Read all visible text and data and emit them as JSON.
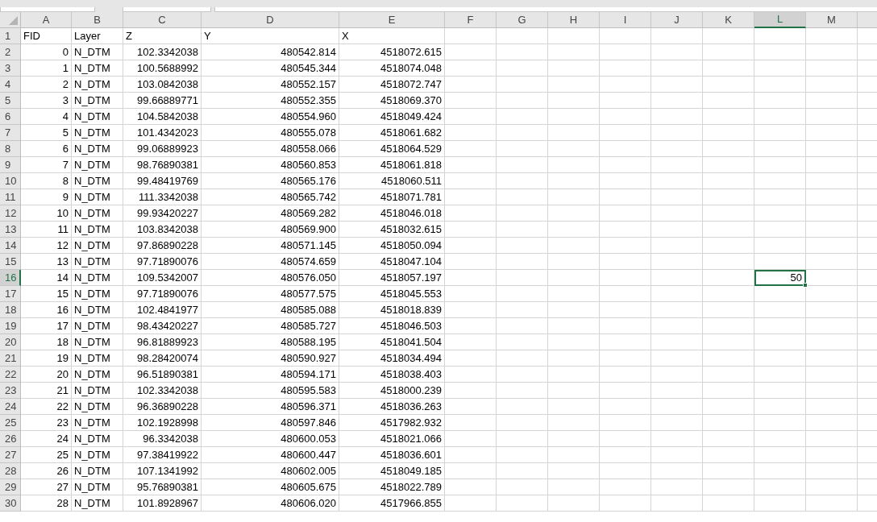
{
  "columns": [
    {
      "label": "A",
      "selected": false
    },
    {
      "label": "B",
      "selected": false
    },
    {
      "label": "C",
      "selected": false
    },
    {
      "label": "D",
      "selected": false
    },
    {
      "label": "E",
      "selected": false
    },
    {
      "label": "F",
      "selected": false
    },
    {
      "label": "G",
      "selected": false
    },
    {
      "label": "H",
      "selected": false
    },
    {
      "label": "I",
      "selected": false
    },
    {
      "label": "J",
      "selected": false
    },
    {
      "label": "K",
      "selected": false
    },
    {
      "label": "L",
      "selected": true
    },
    {
      "label": "M",
      "selected": false
    }
  ],
  "rows": [
    {
      "number": "1",
      "kind": "header",
      "selected": false,
      "cells": [
        "FID",
        "Layer",
        "Z",
        "Y",
        "X"
      ]
    },
    {
      "number": "2",
      "kind": "data",
      "selected": false,
      "cells": [
        "0",
        "N_DTM",
        "102.3342038",
        "480542.814",
        "4518072.615"
      ]
    },
    {
      "number": "3",
      "kind": "data",
      "selected": false,
      "cells": [
        "1",
        "N_DTM",
        "100.5688992",
        "480545.344",
        "4518074.048"
      ]
    },
    {
      "number": "4",
      "kind": "data",
      "selected": false,
      "cells": [
        "2",
        "N_DTM",
        "103.0842038",
        "480552.157",
        "4518072.747"
      ]
    },
    {
      "number": "5",
      "kind": "data",
      "selected": false,
      "cells": [
        "3",
        "N_DTM",
        "99.66889771",
        "480552.355",
        "4518069.370"
      ]
    },
    {
      "number": "6",
      "kind": "data",
      "selected": false,
      "cells": [
        "4",
        "N_DTM",
        "104.5842038",
        "480554.960",
        "4518049.424"
      ]
    },
    {
      "number": "7",
      "kind": "data",
      "selected": false,
      "cells": [
        "5",
        "N_DTM",
        "101.4342023",
        "480555.078",
        "4518061.682"
      ]
    },
    {
      "number": "8",
      "kind": "data",
      "selected": false,
      "cells": [
        "6",
        "N_DTM",
        "99.06889923",
        "480558.066",
        "4518064.529"
      ]
    },
    {
      "number": "9",
      "kind": "data",
      "selected": false,
      "cells": [
        "7",
        "N_DTM",
        "98.76890381",
        "480560.853",
        "4518061.818"
      ]
    },
    {
      "number": "10",
      "kind": "data",
      "selected": false,
      "cells": [
        "8",
        "N_DTM",
        "99.48419769",
        "480565.176",
        "4518060.511"
      ]
    },
    {
      "number": "11",
      "kind": "data",
      "selected": false,
      "cells": [
        "9",
        "N_DTM",
        "111.3342038",
        "480565.742",
        "4518071.781"
      ]
    },
    {
      "number": "12",
      "kind": "data",
      "selected": false,
      "cells": [
        "10",
        "N_DTM",
        "99.93420227",
        "480569.282",
        "4518046.018"
      ]
    },
    {
      "number": "13",
      "kind": "data",
      "selected": false,
      "cells": [
        "11",
        "N_DTM",
        "103.8342038",
        "480569.900",
        "4518032.615"
      ]
    },
    {
      "number": "14",
      "kind": "data",
      "selected": false,
      "cells": [
        "12",
        "N_DTM",
        "97.86890228",
        "480571.145",
        "4518050.094"
      ]
    },
    {
      "number": "15",
      "kind": "data",
      "selected": false,
      "cells": [
        "13",
        "N_DTM",
        "97.71890076",
        "480574.659",
        "4518047.104"
      ]
    },
    {
      "number": "16",
      "kind": "data",
      "selected": true,
      "cells": [
        "14",
        "N_DTM",
        "109.5342007",
        "480576.050",
        "4518057.197"
      ]
    },
    {
      "number": "17",
      "kind": "data",
      "selected": false,
      "cells": [
        "15",
        "N_DTM",
        "97.71890076",
        "480577.575",
        "4518045.553"
      ]
    },
    {
      "number": "18",
      "kind": "data",
      "selected": false,
      "cells": [
        "16",
        "N_DTM",
        "102.4841977",
        "480585.088",
        "4518018.839"
      ]
    },
    {
      "number": "19",
      "kind": "data",
      "selected": false,
      "cells": [
        "17",
        "N_DTM",
        "98.43420227",
        "480585.727",
        "4518046.503"
      ]
    },
    {
      "number": "20",
      "kind": "data",
      "selected": false,
      "cells": [
        "18",
        "N_DTM",
        "96.81889923",
        "480588.195",
        "4518041.504"
      ]
    },
    {
      "number": "21",
      "kind": "data",
      "selected": false,
      "cells": [
        "19",
        "N_DTM",
        "98.28420074",
        "480590.927",
        "4518034.494"
      ]
    },
    {
      "number": "22",
      "kind": "data",
      "selected": false,
      "cells": [
        "20",
        "N_DTM",
        "96.51890381",
        "480594.171",
        "4518038.403"
      ]
    },
    {
      "number": "23",
      "kind": "data",
      "selected": false,
      "cells": [
        "21",
        "N_DTM",
        "102.3342038",
        "480595.583",
        "4518000.239"
      ]
    },
    {
      "number": "24",
      "kind": "data",
      "selected": false,
      "cells": [
        "22",
        "N_DTM",
        "96.36890228",
        "480596.371",
        "4518036.263"
      ]
    },
    {
      "number": "25",
      "kind": "data",
      "selected": false,
      "cells": [
        "23",
        "N_DTM",
        "102.1928998",
        "480597.846",
        "4517982.932"
      ]
    },
    {
      "number": "26",
      "kind": "data",
      "selected": false,
      "cells": [
        "24",
        "N_DTM",
        "96.3342038",
        "480600.053",
        "4518021.066"
      ]
    },
    {
      "number": "27",
      "kind": "data",
      "selected": false,
      "cells": [
        "25",
        "N_DTM",
        "97.38419922",
        "480600.447",
        "4518036.601"
      ]
    },
    {
      "number": "28",
      "kind": "data",
      "selected": false,
      "cells": [
        "26",
        "N_DTM",
        "107.1341992",
        "480602.005",
        "4518049.185"
      ]
    },
    {
      "number": "29",
      "kind": "data",
      "selected": false,
      "cells": [
        "27",
        "N_DTM",
        "95.76890381",
        "480605.675",
        "4518022.789"
      ]
    },
    {
      "number": "30",
      "kind": "data",
      "selected": false,
      "cells": [
        "28",
        "N_DTM",
        "101.8928967",
        "480606.020",
        "4517966.855"
      ]
    }
  ],
  "active_cell_value": "50"
}
